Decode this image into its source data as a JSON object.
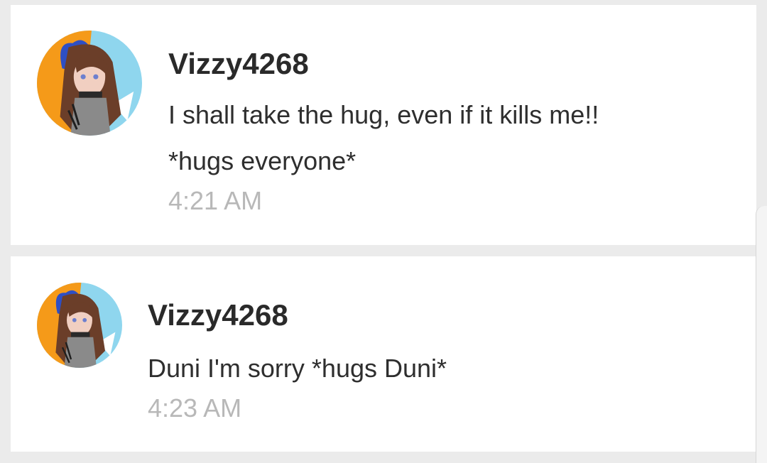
{
  "comments": [
    {
      "username": "Vizzy4268",
      "lines": [
        "I shall take the hug, even if it kills me!!",
        "*hugs everyone*"
      ],
      "time": "4:21 AM"
    },
    {
      "username": "Vizzy4268",
      "lines": [
        "Duni I'm sorry *hugs Duni*"
      ],
      "time": "4:23 AM"
    }
  ],
  "colors": {
    "background": "#ebebeb",
    "card": "#ffffff",
    "username": "#2a2a2a",
    "message": "#2e2e2e",
    "timestamp": "#b8b8b8"
  },
  "icons": {
    "avatar": "user-avatar-anime-character"
  }
}
